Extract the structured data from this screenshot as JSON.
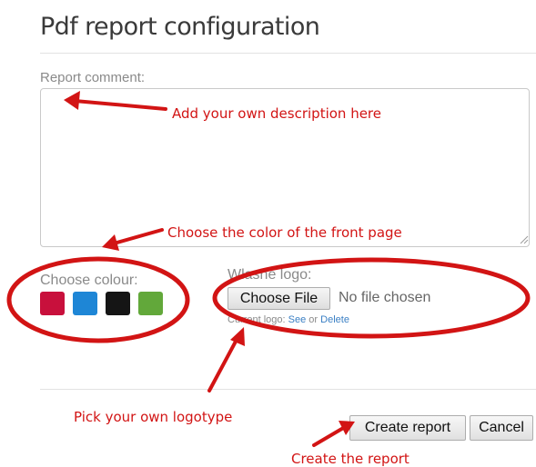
{
  "page": {
    "title": "Pdf report configuration"
  },
  "form": {
    "comment_label": "Report comment:",
    "comment_value": "",
    "colour_label": "Choose colour:",
    "colours": [
      "#c8103c",
      "#1e86d6",
      "#151515",
      "#62a83a"
    ],
    "logo_label": "Własne logo:",
    "choose_file_label": "Choose File",
    "no_file_text": "No file chosen",
    "current_logo_prefix": "Current logo:",
    "see_link": "See",
    "or_text": "or",
    "delete_link": "Delete",
    "create_button": "Create report",
    "cancel_button": "Cancel"
  },
  "annotations": {
    "description": "Add your own description here",
    "front_page_color": "Choose the color of the front page",
    "logotype": "Pick your own logotype",
    "create": "Create the report",
    "color": "#d21414"
  }
}
